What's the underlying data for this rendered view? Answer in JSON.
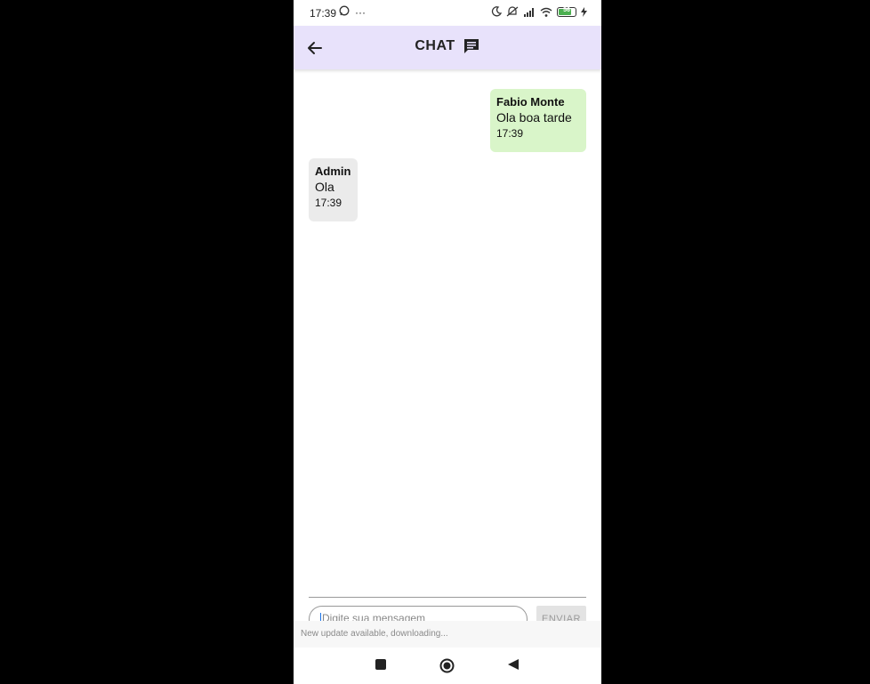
{
  "status_bar": {
    "time": "17:39",
    "overflow": "···",
    "battery_level": "56",
    "icons": [
      "whatsapp-icon",
      "moon-icon",
      "mute-icon",
      "signal-icon",
      "wifi-icon",
      "battery-icon",
      "charging-icon"
    ]
  },
  "app_bar": {
    "title": "CHAT",
    "back_icon": "arrow-left-icon",
    "title_icon": "chat-icon"
  },
  "messages": [
    {
      "sender": "Fabio Monte",
      "text": "Ola boa tarde",
      "time": "17:39",
      "own": true
    },
    {
      "sender": "Admin",
      "text": "Ola",
      "time": "17:39",
      "own": false
    }
  ],
  "composer": {
    "placeholder": "Digite sua mensagem",
    "send_label": "ENVIAR"
  },
  "toast": "New update available, downloading...",
  "nav_bar": {
    "buttons": [
      "recents-icon",
      "home-icon",
      "back-icon"
    ]
  },
  "colors": {
    "app_bar_bg": "#e8e2fb",
    "own_bubble": "#d9f5c9",
    "other_bubble": "#ebebeb",
    "background": "#000000"
  }
}
